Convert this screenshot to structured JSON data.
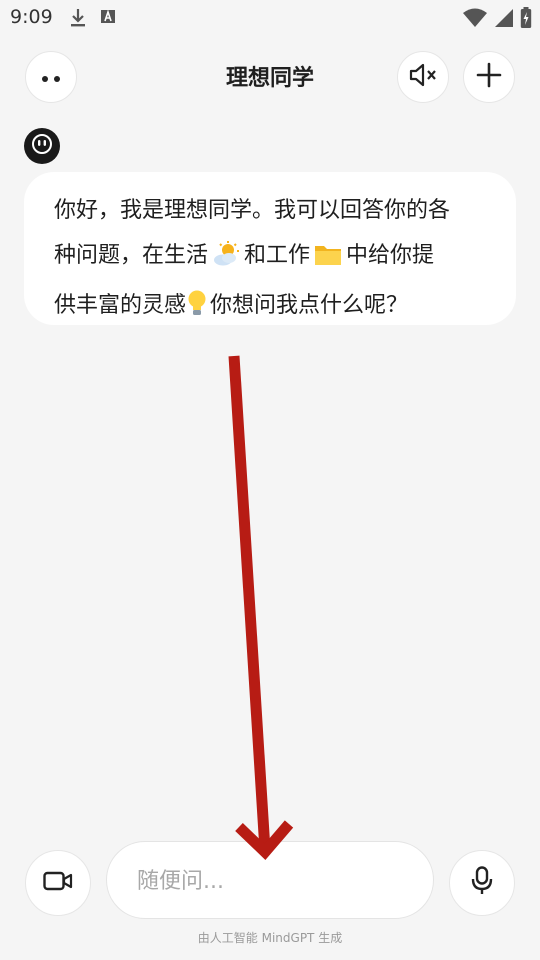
{
  "status_bar": {
    "time": "9:09",
    "icons": [
      "download-icon",
      "text-a-icon",
      "wifi-icon",
      "signal-icon",
      "battery-charging-icon"
    ]
  },
  "header": {
    "title": "理想同学",
    "left_icon": "more-dots-icon",
    "right_icons": [
      "speaker-muted-icon",
      "plus-icon"
    ]
  },
  "chat": {
    "messages": [
      {
        "sender": "assistant",
        "avatar_icon": "robot-face-icon",
        "lines": [
          {
            "text": "你好，我是理想同学。我可以回答你的各"
          },
          {
            "text_before": "种问题，在生活",
            "emoji1": "sun-behind-cloud-icon",
            "text_middle": "和工作",
            "emoji2": "folder-icon",
            "text_after": "中给你提"
          },
          {
            "text_before": "供丰富的灵感",
            "emoji": "light-bulb-icon",
            "text_after": "你想问我点什么呢？"
          }
        ]
      }
    ]
  },
  "input_bar": {
    "placeholder": "随便问...",
    "value": "",
    "left_icon": "video-camera-icon",
    "right_icon": "microphone-icon"
  },
  "footer": {
    "note": "由人工智能 MindGPT 生成"
  },
  "overlay": {
    "annotation": "arrow-down",
    "color": "#b71c14"
  }
}
